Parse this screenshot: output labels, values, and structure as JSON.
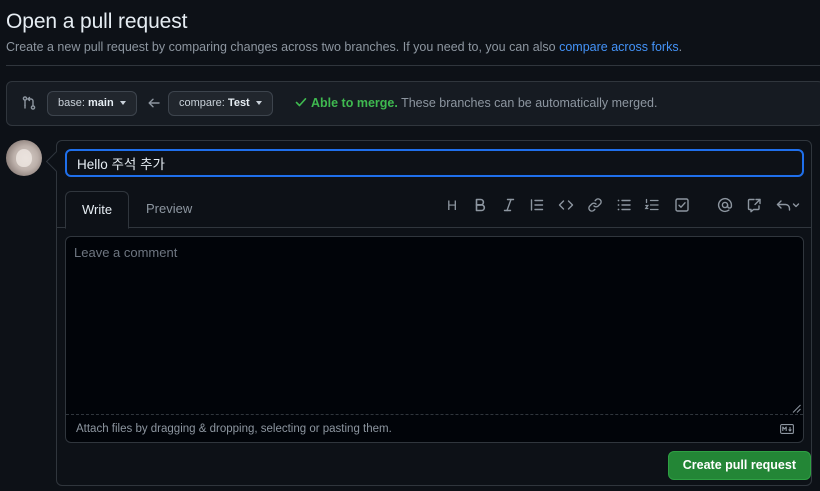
{
  "header": {
    "title": "Open a pull request",
    "subtitle_text": "Create a new pull request by comparing changes across two branches. If you need to, you can also",
    "subtitle_link": "compare across forks",
    "subtitle_end": "."
  },
  "branches": {
    "base_label": "base:",
    "base_value": "main",
    "compare_label": "compare:",
    "compare_value": "Test"
  },
  "merge": {
    "status": "Able to merge.",
    "message": "These branches can be automatically merged."
  },
  "form": {
    "title_value": "Hello 주석 추가",
    "tabs": [
      "Write",
      "Preview"
    ],
    "toolbar_heading": "H",
    "comment_placeholder": "Leave a comment",
    "attach_text": "Attach files by dragging & dropping, selecting or pasting them.",
    "submit_label": "Create pull request"
  },
  "icons": [
    "compare-icon",
    "arrow-left-icon",
    "check-icon",
    "heading-icon",
    "bold-icon",
    "italic-icon",
    "quote-icon",
    "code-icon",
    "link-icon",
    "unordered-list-icon",
    "ordered-list-icon",
    "task-list-icon",
    "mention-icon",
    "cross-reference-icon",
    "saved-reply-icon",
    "markdown-icon"
  ],
  "colors": {
    "accent": "#4493f8",
    "success": "#3fb950",
    "primary_button": "#238636",
    "background": "#0d1117"
  }
}
